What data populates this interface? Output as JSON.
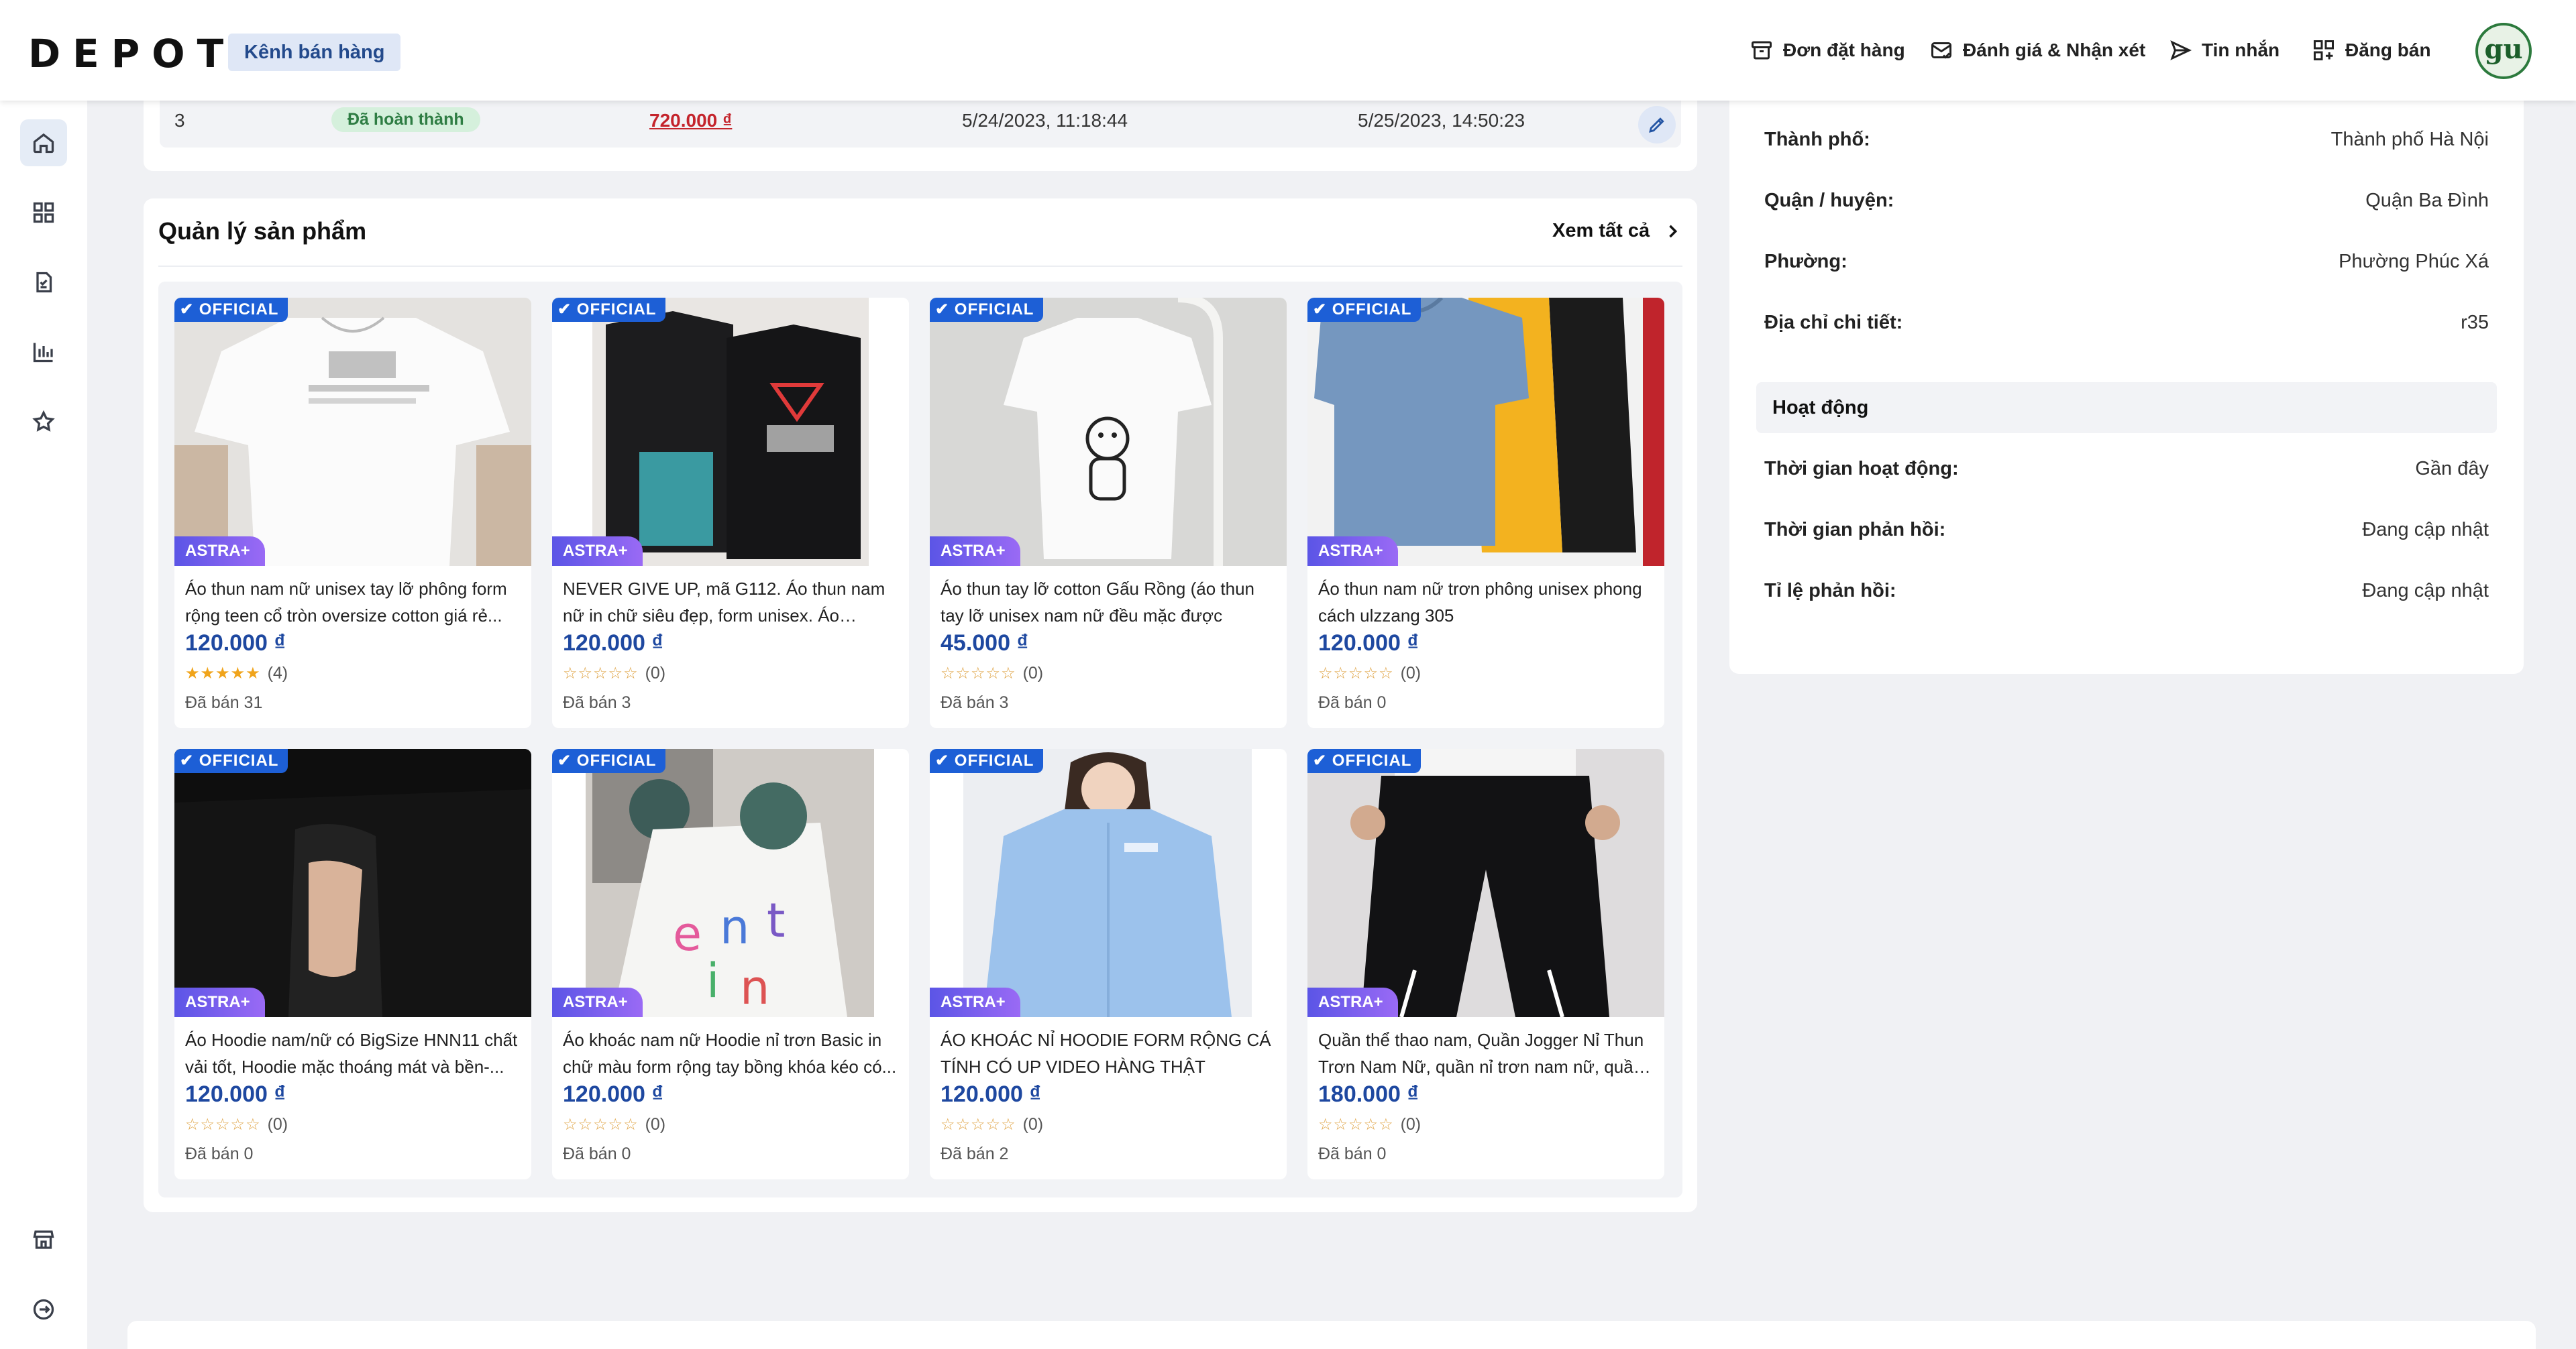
{
  "header": {
    "logo": "DEPOT",
    "channel_label": "Kênh bán hàng",
    "nav": [
      {
        "label": "Đơn đặt hàng",
        "icon": "archive-box-icon"
      },
      {
        "label": "Đánh giá & Nhận xét",
        "icon": "mail-check-icon"
      },
      {
        "label": "Tin nhắn",
        "icon": "send-icon"
      },
      {
        "label": "Đăng bán",
        "icon": "grid-plus-icon"
      }
    ],
    "avatar_text": "gu"
  },
  "sidebar": {
    "items": [
      "home-icon",
      "grid-icon",
      "document-icon",
      "chart-icon",
      "star-icon"
    ],
    "bottom_items": [
      "store-icon",
      "logout-icon"
    ]
  },
  "orders_table": {
    "row": {
      "index": "3",
      "status": "Đã hoàn thành",
      "total": "720.000 ₫",
      "created": "5/24/2023, 11:18:44",
      "updated": "5/25/2023, 14:50:23"
    }
  },
  "products": {
    "title": "Quản lý sản phẩm",
    "see_all": "Xem tất cả",
    "official_label": "OFFICIAL",
    "astra_label": "ASTRA+",
    "items": [
      {
        "name": "Áo thun nam nữ unisex tay lỡ phông form rộng teen cổ tròn oversize cotton giá rẻ...",
        "price": "120.000 ₫",
        "stars": "★★★★★",
        "rating": "(4)",
        "sold": "Đã bán 31"
      },
      {
        "name": "NEVER GIVE UP, mã G112. Áo thun nam nữ in chữ siêu đẹp, form unisex. Áo phông...",
        "price": "120.000 ₫",
        "stars": "☆☆☆☆☆",
        "rating": "(0)",
        "sold": "Đã bán 3"
      },
      {
        "name": "Áo thun tay lỡ cotton Gấu Rồng (áo thun tay lỡ unisex nam nữ đều mặc được",
        "price": "45.000 ₫",
        "stars": "☆☆☆☆☆",
        "rating": "(0)",
        "sold": "Đã bán 3"
      },
      {
        "name": "Áo thun nam nữ trơn phông unisex phong cách ulzzang 305",
        "price": "120.000 ₫",
        "stars": "☆☆☆☆☆",
        "rating": "(0)",
        "sold": "Đã bán 0"
      },
      {
        "name": "Áo Hoodie nam/nữ có BigSize HNN11 chất vải tốt, Hoodie mặc thoáng mát và bền-...",
        "price": "120.000 ₫",
        "stars": "☆☆☆☆☆",
        "rating": "(0)",
        "sold": "Đã bán 0"
      },
      {
        "name": "Áo khoác nam nữ Hoodie nỉ trơn Basic in chữ màu form rộng tay bồng khóa kéo có...",
        "price": "120.000 ₫",
        "stars": "☆☆☆☆☆",
        "rating": "(0)",
        "sold": "Đã bán 0"
      },
      {
        "name": "ÁO KHOÁC NỈ HOODIE FORM RỘNG CÁ TÍNH CÓ UP VIDEO HÀNG THẬT",
        "price": "120.000 ₫",
        "stars": "☆☆☆☆☆",
        "rating": "(0)",
        "sold": "Đã bán 2"
      },
      {
        "name": "Quần thể thao nam, Quần Jogger Nỉ Thun Trơn Nam Nữ, quần nỉ trơn nam nữ, quần ...",
        "price": "180.000 ₫",
        "stars": "☆☆☆☆☆",
        "rating": "(0)",
        "sold": "Đã bán 0"
      }
    ]
  },
  "shop_info": {
    "address": [
      {
        "label": "Thành phố:",
        "value": "Thành phố Hà Nội"
      },
      {
        "label": "Quận / huyện:",
        "value": "Quận Ba Đình"
      },
      {
        "label": "Phường:",
        "value": "Phường Phúc Xá"
      },
      {
        "label": "Địa chỉ chi tiết:",
        "value": "r35"
      }
    ],
    "activity_title": "Hoạt động",
    "activity": [
      {
        "label": "Thời gian hoạt động:",
        "value": "Gần đây"
      },
      {
        "label": "Thời gian phản hồi:",
        "value": "Đang cập nhật"
      },
      {
        "label": "Tỉ lệ phản hồi:",
        "value": "Đang cập nhật"
      }
    ]
  },
  "colors": {
    "primary": "#1e48a0",
    "official_badge": "#1d5fd6",
    "astra_badge": "#7a60ee",
    "status_done_bg": "#d5f0dc",
    "price_red": "#c4242c"
  }
}
